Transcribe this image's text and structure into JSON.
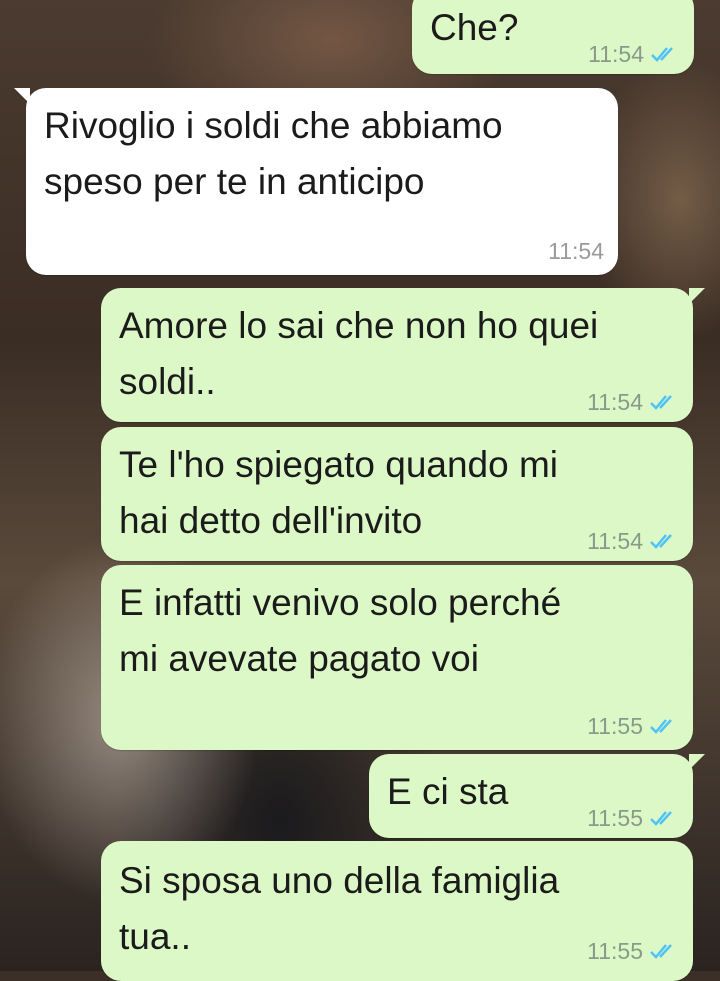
{
  "colors": {
    "outgoing_bubble": "#dcf8c6",
    "incoming_bubble": "#ffffff",
    "read_tick": "#4fc3f7"
  },
  "messages": [
    {
      "direction": "outgoing",
      "text": "Che?",
      "time": "11:54",
      "status_icon": "double-check-read-icon"
    },
    {
      "direction": "incoming",
      "text": "Rivoglio i soldi che abbiamo\nspeso per te in anticipo",
      "time": "11:54"
    },
    {
      "direction": "outgoing",
      "text": "Amore lo sai che non ho quei\nsoldi..",
      "time": "11:54",
      "status_icon": "double-check-read-icon"
    },
    {
      "direction": "outgoing",
      "text": "Te l'ho spiegato quando mi\nhai detto dell'invito",
      "time": "11:54",
      "status_icon": "double-check-read-icon"
    },
    {
      "direction": "outgoing",
      "text": "E infatti venivo solo perché\nmi avevate pagato voi",
      "time": "11:55",
      "status_icon": "double-check-read-icon"
    },
    {
      "direction": "outgoing",
      "text": "E ci sta",
      "time": "11:55",
      "status_icon": "double-check-read-icon"
    },
    {
      "direction": "outgoing",
      "text": "Si sposa uno della famiglia\ntua..",
      "time": "11:55",
      "status_icon": "double-check-read-icon"
    }
  ]
}
